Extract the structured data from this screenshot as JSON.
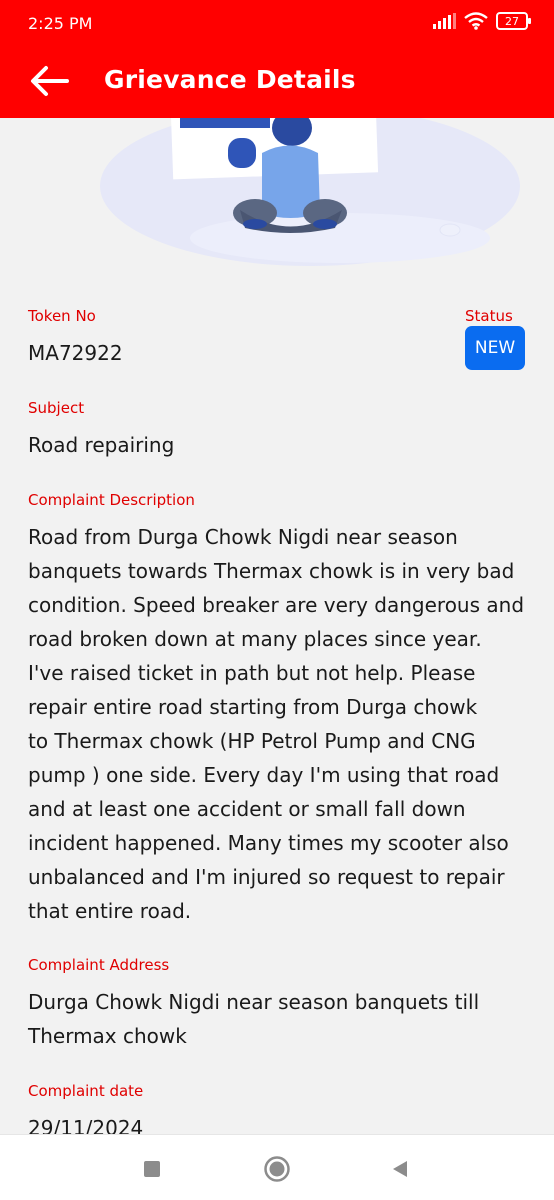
{
  "status_bar": {
    "time": "2:25 PM",
    "battery": "27"
  },
  "app_bar": {
    "title": "Grievance Details",
    "back_icon": "arrow-left-icon"
  },
  "grievance": {
    "token_label": "Token No",
    "token_value": "MA72922",
    "status_label": "Status",
    "status_value": "NEW",
    "subject_label": "Subject",
    "subject_value": "Road repairing",
    "description_label": "Complaint Description",
    "description_value": " Road from Durga Chowk Nigdi near season\nbanquets towards Thermax chowk is in very bad\ncondition. Speed breaker are very dangerous and\nroad broken down at many places since year.\nI've raised ticket in path but not help. Please\nrepair entire road starting from Durga chowk\nto Thermax chowk  (HP Petrol Pump and CNG\npump ) one side. Every day I'm using that road\nand at least one accident or small fall down\nincident happened. Many times my scooter also\nunbalanced and I'm injured so request to repair\nthat entire road.",
    "address_label": "Complaint Address",
    "address_value": "Durga Chowk Nigdi near season banquets till\nThermax chowk",
    "date_label": "Complaint date",
    "date_value": "29/11/2024"
  },
  "colors": {
    "primary": "#ff0000",
    "label": "#e00000",
    "badge": "#0a6cf0",
    "background": "#f2f2f2"
  },
  "nav": {
    "icons": [
      "square-recents-icon",
      "circle-home-icon",
      "triangle-back-icon"
    ]
  }
}
